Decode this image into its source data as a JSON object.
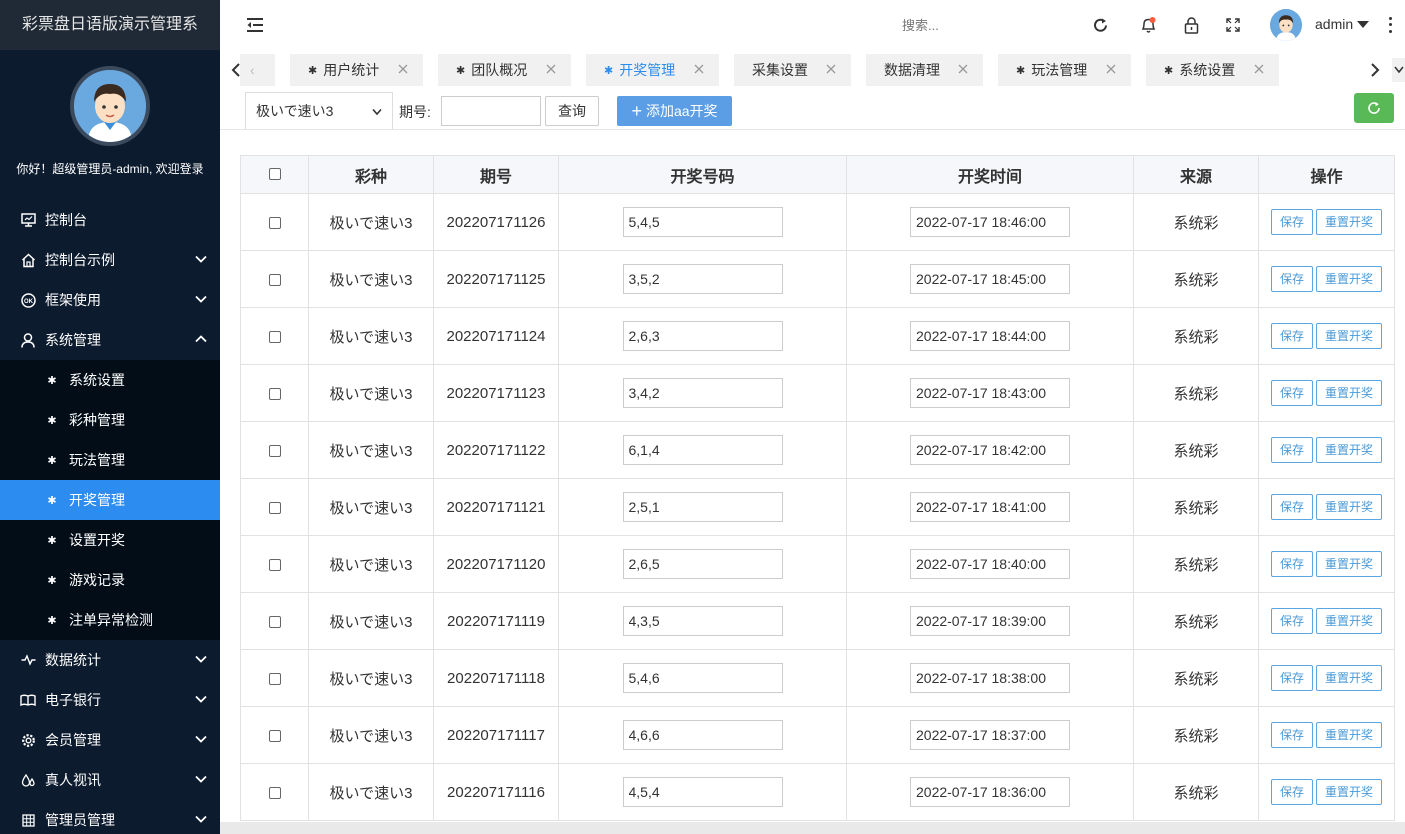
{
  "brand": "彩票盘日语版演示管理系",
  "profile": {
    "welcome": "你好！超级管理员-admin, 欢迎登录"
  },
  "sidebar": {
    "items": [
      {
        "label": "控制台",
        "icon": "monitor-icon",
        "chevron": "none"
      },
      {
        "label": "控制台示例",
        "icon": "home-icon",
        "chevron": "down"
      },
      {
        "label": "框架使用",
        "icon": "ok-icon",
        "chevron": "down"
      },
      {
        "label": "系统管理",
        "icon": "user-icon",
        "chevron": "up"
      }
    ],
    "subitems": [
      {
        "label": "系统设置"
      },
      {
        "label": "彩种管理"
      },
      {
        "label": "玩法管理"
      },
      {
        "label": "开奖管理",
        "active": true
      },
      {
        "label": "设置开奖"
      },
      {
        "label": "游戏记录"
      },
      {
        "label": "注单异常检测"
      }
    ],
    "items_after": [
      {
        "label": "数据统计",
        "icon": "pulse-icon"
      },
      {
        "label": "电子银行",
        "icon": "bank-icon"
      },
      {
        "label": "会员管理",
        "icon": "gear-icon"
      },
      {
        "label": "真人视讯",
        "icon": "drops-icon"
      },
      {
        "label": "管理员管理",
        "icon": "grid-icon"
      }
    ]
  },
  "header": {
    "search_placeholder": "搜索...",
    "username": "admin",
    "icons": [
      "refresh-icon",
      "bell-icon",
      "lock-icon",
      "fullscreen-icon"
    ]
  },
  "tabs": [
    {
      "label": "用户统计"
    },
    {
      "label": "团队概况"
    },
    {
      "label": "开奖管理",
      "active": true
    },
    {
      "label": "采集设置"
    },
    {
      "label": "数据清理"
    },
    {
      "label": "玩法管理"
    },
    {
      "label": "系统设置"
    }
  ],
  "toolbar": {
    "select_value": "极いで速い3",
    "period_label": "期号:",
    "period_value": "",
    "query_label": "查询",
    "add_label": "添加aa开奖"
  },
  "table": {
    "headers": [
      "彩种",
      "期号",
      "开奖号码",
      "开奖时间",
      "来源",
      "操作"
    ],
    "save_label": "保存",
    "reset_label": "重置开奖",
    "rows": [
      {
        "game": "极いで速い3",
        "period": "202207171126",
        "numbers": "5,4,5",
        "time": "2022-07-17 18:46:00",
        "source": "系统彩"
      },
      {
        "game": "极いで速い3",
        "period": "202207171125",
        "numbers": "3,5,2",
        "time": "2022-07-17 18:45:00",
        "source": "系统彩"
      },
      {
        "game": "极いで速い3",
        "period": "202207171124",
        "numbers": "2,6,3",
        "time": "2022-07-17 18:44:00",
        "source": "系统彩"
      },
      {
        "game": "极いで速い3",
        "period": "202207171123",
        "numbers": "3,4,2",
        "time": "2022-07-17 18:43:00",
        "source": "系统彩"
      },
      {
        "game": "极いで速い3",
        "period": "202207171122",
        "numbers": "6,1,4",
        "time": "2022-07-17 18:42:00",
        "source": "系统彩"
      },
      {
        "game": "极いで速い3",
        "period": "202207171121",
        "numbers": "2,5,1",
        "time": "2022-07-17 18:41:00",
        "source": "系统彩"
      },
      {
        "game": "极いで速い3",
        "period": "202207171120",
        "numbers": "2,6,5",
        "time": "2022-07-17 18:40:00",
        "source": "系统彩"
      },
      {
        "game": "极いで速い3",
        "period": "202207171119",
        "numbers": "4,3,5",
        "time": "2022-07-17 18:39:00",
        "source": "系统彩"
      },
      {
        "game": "极いで速い3",
        "period": "202207171118",
        "numbers": "5,4,6",
        "time": "2022-07-17 18:38:00",
        "source": "系统彩"
      },
      {
        "game": "极いで速い3",
        "period": "202207171117",
        "numbers": "4,6,6",
        "time": "2022-07-17 18:37:00",
        "source": "系统彩"
      },
      {
        "game": "极いで速い3",
        "period": "202207171116",
        "numbers": "4,5,4",
        "time": "2022-07-17 18:36:00",
        "source": "系统彩"
      }
    ]
  },
  "colors": {
    "sidebar_bg": "#0c1b2e",
    "active": "#2d8cf0",
    "add_button": "#5b9ee6",
    "refresh_button": "#58b956"
  }
}
